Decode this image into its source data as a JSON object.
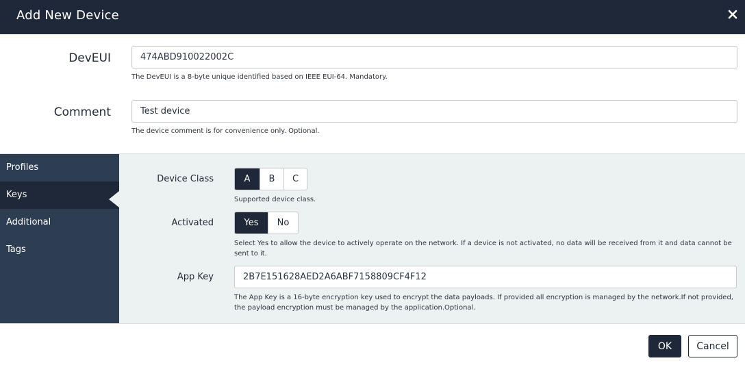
{
  "dialog": {
    "title": "Add New Device"
  },
  "deveui": {
    "label": "DevEUI",
    "value": "474ABD910022002C",
    "help": "The DevEUI is a 8-byte unique identified based on IEEE EUI-64. Mandatory."
  },
  "comment": {
    "label": "Comment",
    "value": "Test device",
    "help": "The device comment is for convenience only. Optional."
  },
  "sidebar": {
    "items": [
      {
        "label": "Profiles",
        "active": false
      },
      {
        "label": "Keys",
        "active": true
      },
      {
        "label": "Additional",
        "active": false
      },
      {
        "label": "Tags",
        "active": false
      }
    ]
  },
  "keys": {
    "device_class": {
      "label": "Device Class",
      "options": [
        "A",
        "B",
        "C"
      ],
      "selected": "A",
      "help": "Supported device class."
    },
    "activated": {
      "label": "Activated",
      "options": [
        "Yes",
        "No"
      ],
      "selected": "Yes",
      "help": "Select Yes to allow the device to actively operate on the network. If a device is not activated, no data will be received from it and data cannot be sent to it."
    },
    "app_key": {
      "label": "App Key",
      "value": "2B7E151628AED2A6ABF7158809CF4F12",
      "help": "The App Key is a 16-byte encryption key used to encrypt the data payloads. If provided all encryption is managed by the network.If not provided, the payload encryption must be managed by the application.Optional."
    }
  },
  "footer": {
    "ok_label": "OK",
    "cancel_label": "Cancel"
  },
  "colors": {
    "header_bg": "#1e2838",
    "sidebar_bg": "#2e3e52",
    "panel_bg": "#ecf1f1",
    "selected_bg": "#1e2838"
  },
  "icons": {
    "close": "close-icon"
  }
}
